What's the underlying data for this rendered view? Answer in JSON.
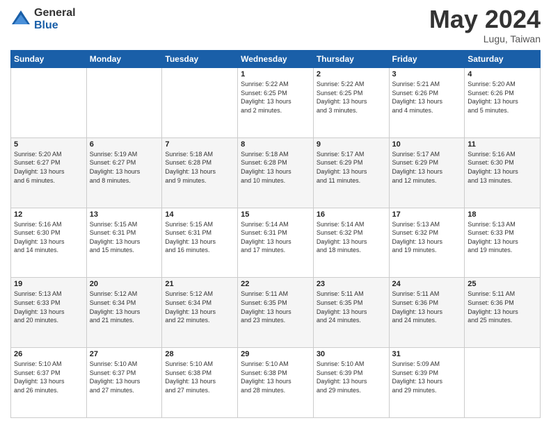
{
  "logo": {
    "general": "General",
    "blue": "Blue"
  },
  "title": "May 2024",
  "location": "Lugu, Taiwan",
  "days_of_week": [
    "Sunday",
    "Monday",
    "Tuesday",
    "Wednesday",
    "Thursday",
    "Friday",
    "Saturday"
  ],
  "weeks": [
    [
      {
        "day": "",
        "info": ""
      },
      {
        "day": "",
        "info": ""
      },
      {
        "day": "",
        "info": ""
      },
      {
        "day": "1",
        "info": "Sunrise: 5:22 AM\nSunset: 6:25 PM\nDaylight: 13 hours\nand 2 minutes."
      },
      {
        "day": "2",
        "info": "Sunrise: 5:22 AM\nSunset: 6:25 PM\nDaylight: 13 hours\nand 3 minutes."
      },
      {
        "day": "3",
        "info": "Sunrise: 5:21 AM\nSunset: 6:26 PM\nDaylight: 13 hours\nand 4 minutes."
      },
      {
        "day": "4",
        "info": "Sunrise: 5:20 AM\nSunset: 6:26 PM\nDaylight: 13 hours\nand 5 minutes."
      }
    ],
    [
      {
        "day": "5",
        "info": "Sunrise: 5:20 AM\nSunset: 6:27 PM\nDaylight: 13 hours\nand 6 minutes."
      },
      {
        "day": "6",
        "info": "Sunrise: 5:19 AM\nSunset: 6:27 PM\nDaylight: 13 hours\nand 8 minutes."
      },
      {
        "day": "7",
        "info": "Sunrise: 5:18 AM\nSunset: 6:28 PM\nDaylight: 13 hours\nand 9 minutes."
      },
      {
        "day": "8",
        "info": "Sunrise: 5:18 AM\nSunset: 6:28 PM\nDaylight: 13 hours\nand 10 minutes."
      },
      {
        "day": "9",
        "info": "Sunrise: 5:17 AM\nSunset: 6:29 PM\nDaylight: 13 hours\nand 11 minutes."
      },
      {
        "day": "10",
        "info": "Sunrise: 5:17 AM\nSunset: 6:29 PM\nDaylight: 13 hours\nand 12 minutes."
      },
      {
        "day": "11",
        "info": "Sunrise: 5:16 AM\nSunset: 6:30 PM\nDaylight: 13 hours\nand 13 minutes."
      }
    ],
    [
      {
        "day": "12",
        "info": "Sunrise: 5:16 AM\nSunset: 6:30 PM\nDaylight: 13 hours\nand 14 minutes."
      },
      {
        "day": "13",
        "info": "Sunrise: 5:15 AM\nSunset: 6:31 PM\nDaylight: 13 hours\nand 15 minutes."
      },
      {
        "day": "14",
        "info": "Sunrise: 5:15 AM\nSunset: 6:31 PM\nDaylight: 13 hours\nand 16 minutes."
      },
      {
        "day": "15",
        "info": "Sunrise: 5:14 AM\nSunset: 6:31 PM\nDaylight: 13 hours\nand 17 minutes."
      },
      {
        "day": "16",
        "info": "Sunrise: 5:14 AM\nSunset: 6:32 PM\nDaylight: 13 hours\nand 18 minutes."
      },
      {
        "day": "17",
        "info": "Sunrise: 5:13 AM\nSunset: 6:32 PM\nDaylight: 13 hours\nand 19 minutes."
      },
      {
        "day": "18",
        "info": "Sunrise: 5:13 AM\nSunset: 6:33 PM\nDaylight: 13 hours\nand 19 minutes."
      }
    ],
    [
      {
        "day": "19",
        "info": "Sunrise: 5:13 AM\nSunset: 6:33 PM\nDaylight: 13 hours\nand 20 minutes."
      },
      {
        "day": "20",
        "info": "Sunrise: 5:12 AM\nSunset: 6:34 PM\nDaylight: 13 hours\nand 21 minutes."
      },
      {
        "day": "21",
        "info": "Sunrise: 5:12 AM\nSunset: 6:34 PM\nDaylight: 13 hours\nand 22 minutes."
      },
      {
        "day": "22",
        "info": "Sunrise: 5:11 AM\nSunset: 6:35 PM\nDaylight: 13 hours\nand 23 minutes."
      },
      {
        "day": "23",
        "info": "Sunrise: 5:11 AM\nSunset: 6:35 PM\nDaylight: 13 hours\nand 24 minutes."
      },
      {
        "day": "24",
        "info": "Sunrise: 5:11 AM\nSunset: 6:36 PM\nDaylight: 13 hours\nand 24 minutes."
      },
      {
        "day": "25",
        "info": "Sunrise: 5:11 AM\nSunset: 6:36 PM\nDaylight: 13 hours\nand 25 minutes."
      }
    ],
    [
      {
        "day": "26",
        "info": "Sunrise: 5:10 AM\nSunset: 6:37 PM\nDaylight: 13 hours\nand 26 minutes."
      },
      {
        "day": "27",
        "info": "Sunrise: 5:10 AM\nSunset: 6:37 PM\nDaylight: 13 hours\nand 27 minutes."
      },
      {
        "day": "28",
        "info": "Sunrise: 5:10 AM\nSunset: 6:38 PM\nDaylight: 13 hours\nand 27 minutes."
      },
      {
        "day": "29",
        "info": "Sunrise: 5:10 AM\nSunset: 6:38 PM\nDaylight: 13 hours\nand 28 minutes."
      },
      {
        "day": "30",
        "info": "Sunrise: 5:10 AM\nSunset: 6:39 PM\nDaylight: 13 hours\nand 29 minutes."
      },
      {
        "day": "31",
        "info": "Sunrise: 5:09 AM\nSunset: 6:39 PM\nDaylight: 13 hours\nand 29 minutes."
      },
      {
        "day": "",
        "info": ""
      }
    ]
  ]
}
